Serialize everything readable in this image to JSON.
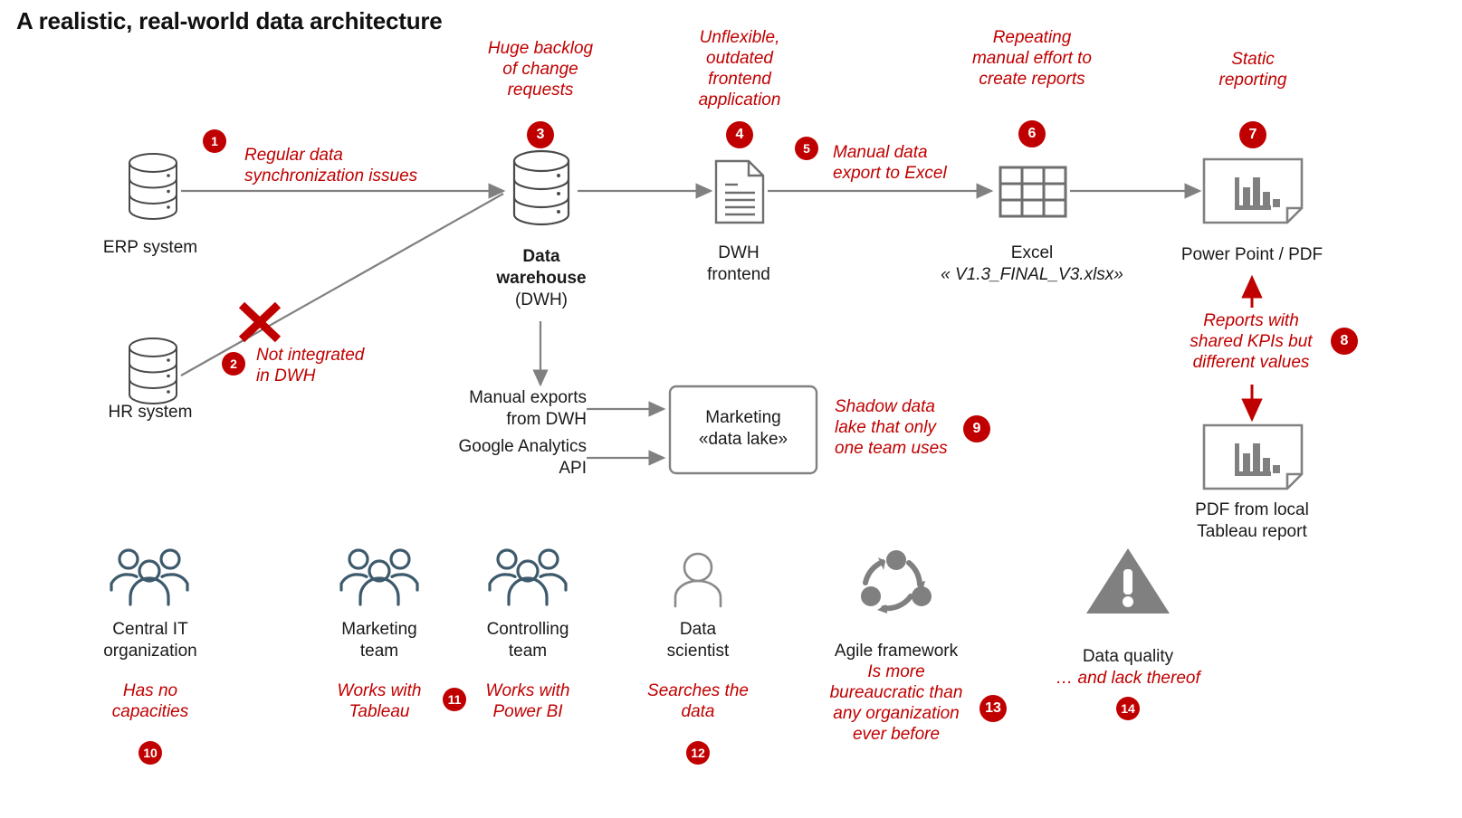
{
  "title": "A realistic, real-world data architecture",
  "colors": {
    "accent_red": "#C00000",
    "arrow_gray": "#808080",
    "icon_gray": "#808080",
    "people_blue": "#3d5a6c",
    "text_black": "#1a1a1a"
  },
  "flow": {
    "nodes": [
      {
        "id": "erp",
        "icon": "database-icon",
        "label": "ERP system"
      },
      {
        "id": "hr",
        "icon": "database-icon",
        "label": "HR system"
      },
      {
        "id": "dwh",
        "icon": "database-icon",
        "label_bold": "Data\nwarehouse",
        "label_plain": "(DWH)"
      },
      {
        "id": "frontend",
        "icon": "document-icon",
        "label": "DWH\nfrontend"
      },
      {
        "id": "excel",
        "icon": "table-icon",
        "label": "Excel",
        "label_italic": "« V1.3_FINAL_V3.xlsx»"
      },
      {
        "id": "powerpoint",
        "icon": "report-chart-icon",
        "label": "Power Point / PDF"
      },
      {
        "id": "tableau_pdf",
        "icon": "report-chart-icon",
        "label": "PDF from local\nTableau report"
      },
      {
        "id": "datalake",
        "icon": "box-icon",
        "label": "Marketing\n«data lake»"
      }
    ],
    "edge_labels": {
      "manual_exports": "Manual exports\nfrom DWH",
      "google_analytics": "Google Analytics\nAPI"
    }
  },
  "annotations": [
    {
      "num": "1",
      "text": "Regular data\nsynchronization issues"
    },
    {
      "num": "2",
      "text": "Not integrated\nin DWH"
    },
    {
      "num": "3",
      "text": "Huge backlog\nof change\nrequests"
    },
    {
      "num": "4",
      "text": "Unflexible,\noutdated\nfrontend\napplication"
    },
    {
      "num": "5",
      "text": "Manual data\nexport to Excel"
    },
    {
      "num": "6",
      "text": "Repeating\nmanual effort to\ncreate reports"
    },
    {
      "num": "7",
      "text": "Static\nreporting"
    },
    {
      "num": "8",
      "text": "Reports with\nshared KPIs but\ndifferent values"
    },
    {
      "num": "9",
      "text": "Shadow data\nlake that only\none team uses"
    }
  ],
  "actors": [
    {
      "id": "central-it",
      "icon": "people-group-icon",
      "label": "Central IT\norganization",
      "note": "Has no\ncapacities",
      "num": "10"
    },
    {
      "id": "marketing",
      "icon": "people-group-icon",
      "label": "Marketing\nteam",
      "note": "Works with\nTableau",
      "num": "11"
    },
    {
      "id": "controlling",
      "icon": "people-group-icon",
      "label": "Controlling\nteam",
      "note": "Works with\nPower BI",
      "num": ""
    },
    {
      "id": "data-scientist",
      "icon": "person-icon",
      "label": "Data\nscientist",
      "note": "Searches the\ndata",
      "num": "12"
    },
    {
      "id": "agile",
      "icon": "cycle-icon",
      "label": "Agile framework",
      "note": "Is more\nbureaucratic than\nany organization\never before",
      "num": "13"
    },
    {
      "id": "data-quality",
      "icon": "warning-icon",
      "label": "Data quality",
      "note": "… and lack thereof",
      "num": "14"
    }
  ]
}
